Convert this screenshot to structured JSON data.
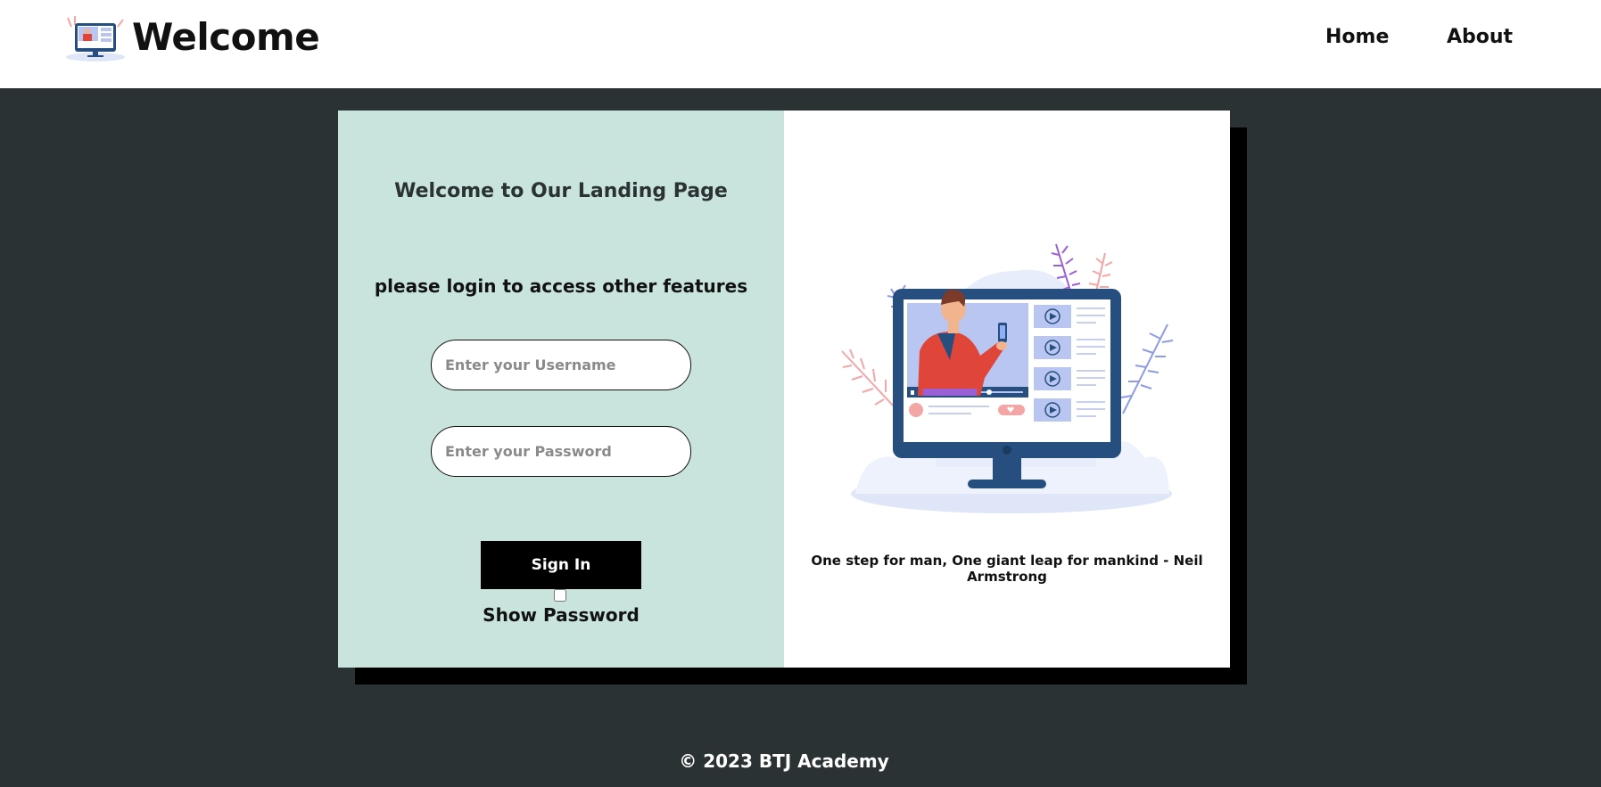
{
  "header": {
    "brand": "Welcome",
    "logo_icon": "monitor-presenter-icon",
    "nav": [
      {
        "label": "Home"
      },
      {
        "label": "About"
      }
    ]
  },
  "login": {
    "title": "Welcome to Our Landing Page",
    "subtitle": "please login to access other features",
    "username_placeholder": "Enter your Username",
    "username_value": "",
    "password_placeholder": "Enter your Password",
    "password_value": "",
    "signin_label": "Sign In",
    "show_password_label": "Show Password",
    "show_password_checked": false
  },
  "side": {
    "illustration_icon": "video-lesson-illustration",
    "quote": "One step for man, One giant leap for mankind - Neil Armstrong"
  },
  "footer": {
    "text": "© 2023 BTJ Academy"
  },
  "colors": {
    "page_background": "#2b3233",
    "login_panel": "#c9e4dd",
    "button": "#000000",
    "monitor": "#264f7f",
    "accent_red": "#e0453a"
  }
}
